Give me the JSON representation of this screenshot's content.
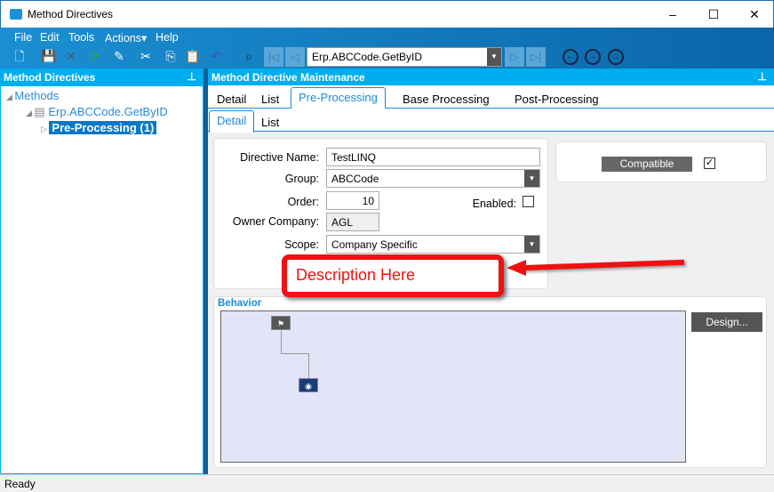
{
  "window": {
    "title": "Method Directives",
    "minimize": "–",
    "maximize": "☐",
    "close": "✕"
  },
  "menu": [
    "File",
    "Edit",
    "Tools",
    "Actions▾",
    "Help"
  ],
  "toolbar": {
    "record_combo": "Erp.ABCCode.GetByID"
  },
  "left_panel": {
    "title": "Method Directives",
    "tree": {
      "root": "Methods",
      "method": "Erp.ABCCode.GetByID",
      "child": "Pre-Processing (1)"
    }
  },
  "main_panel": {
    "title": "Method Directive Maintenance"
  },
  "tabs": [
    "Detail",
    "List",
    "Pre-Processing",
    "Base Processing",
    "Post-Processing"
  ],
  "subtabs": [
    "Detail",
    "List"
  ],
  "form": {
    "directive_name_label": "Directive Name:",
    "directive_name": "TestLINQ",
    "group_label": "Group:",
    "group": "ABCCode",
    "order_label": "Order:",
    "order": "10",
    "enabled_label": "Enabled:",
    "enabled": false,
    "owner_company_label": "Owner Company:",
    "owner_company": "AGL",
    "scope_label": "Scope:",
    "scope": "Company Specific"
  },
  "compatible": {
    "label": "Compatible",
    "checked": true
  },
  "annotation": {
    "text": "Description Here",
    "color": "#ee1111"
  },
  "behavior": {
    "title": "Behavior",
    "design_button": "Design..."
  },
  "status": "Ready"
}
